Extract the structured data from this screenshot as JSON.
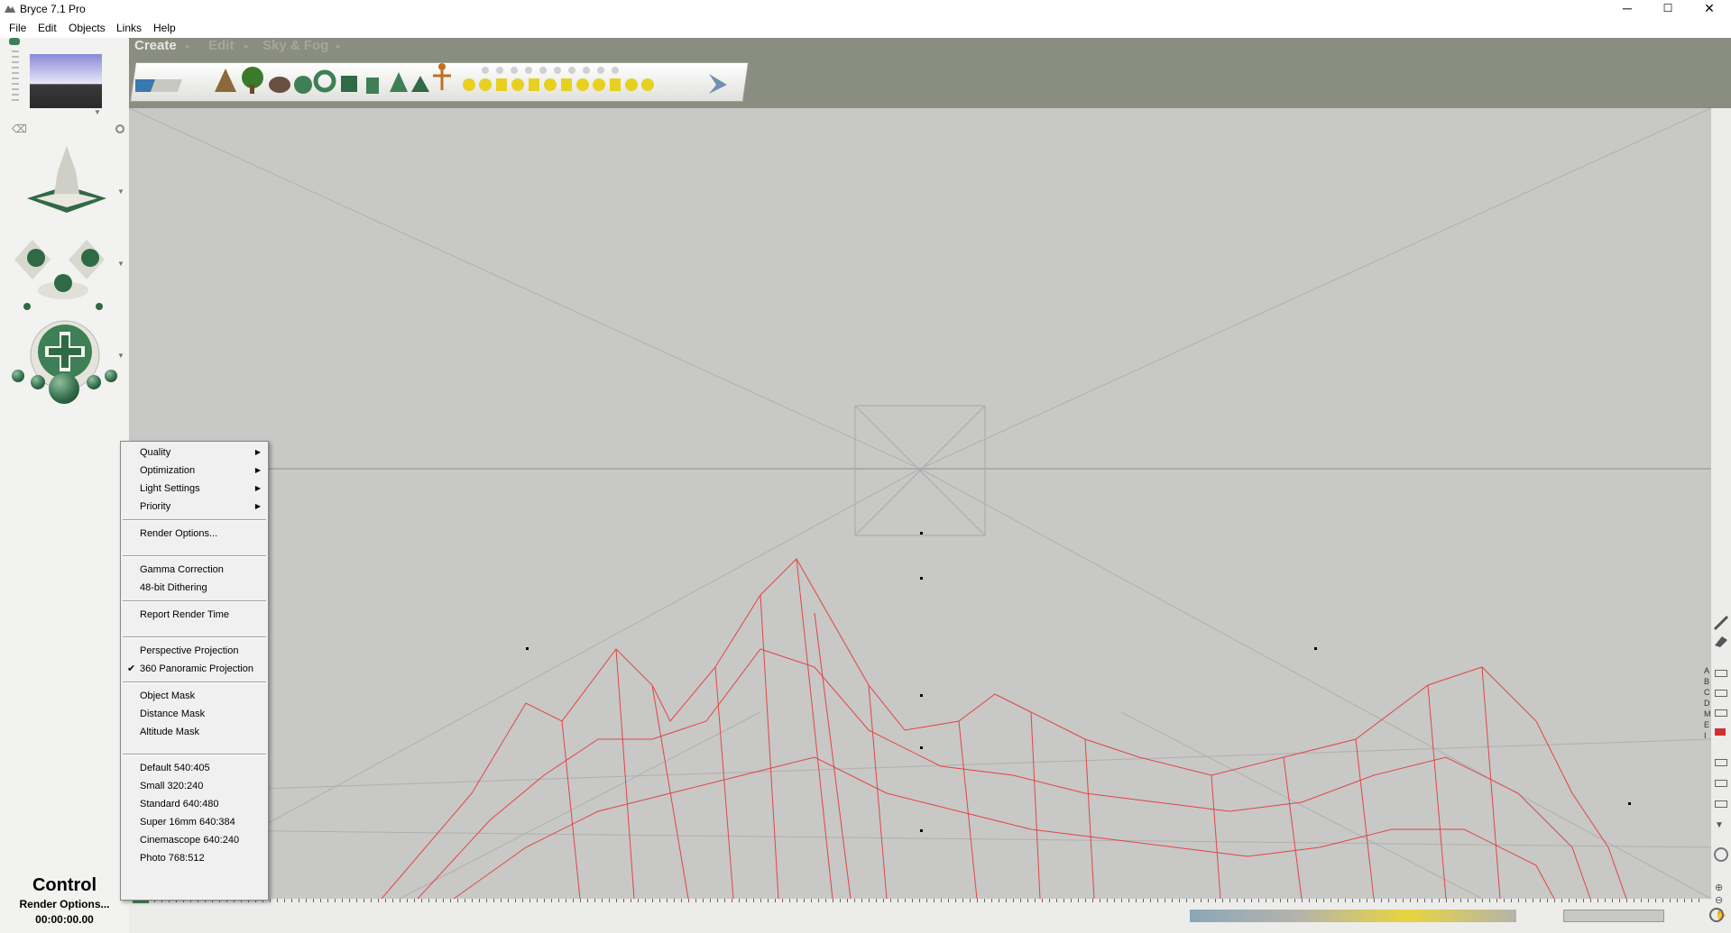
{
  "window": {
    "title": "Bryce 7.1  Pro",
    "controls": {
      "minimize": "─",
      "maximize": "☐",
      "close": "✕"
    }
  },
  "menubar": {
    "items": [
      "File",
      "Edit",
      "Objects",
      "Links",
      "Help"
    ]
  },
  "palettes": {
    "tabs": [
      "Create",
      "Edit",
      "Sky & Fog"
    ]
  },
  "context_menu": {
    "items": [
      {
        "label": "Quality",
        "submenu": true
      },
      {
        "label": "Optimization",
        "submenu": true
      },
      {
        "label": "Light Settings",
        "submenu": true
      },
      {
        "label": "Priority",
        "submenu": true
      },
      {
        "label": "Render Options..."
      },
      {
        "label": "Gamma Correction"
      },
      {
        "label": "48-bit Dithering"
      },
      {
        "label": "Report Render Time"
      },
      {
        "label": "Perspective Projection"
      },
      {
        "label": "360 Panoramic Projection",
        "checked": true
      },
      {
        "label": "Object Mask"
      },
      {
        "label": "Distance Mask"
      },
      {
        "label": "Altitude Mask"
      },
      {
        "label": "Default 540:405"
      },
      {
        "label": "Small 320:240"
      },
      {
        "label": "Standard 640:480"
      },
      {
        "label": "Super 16mm 640:384"
      },
      {
        "label": "Cinemascope 640:240"
      },
      {
        "label": "Photo 768:512"
      }
    ]
  },
  "control_panel": {
    "title": "Control",
    "subtitle": "Render Options...",
    "time": "00:00:00.00"
  },
  "right_labels": [
    "A",
    "B",
    "C",
    "D",
    "M",
    "E",
    "I"
  ],
  "colors": {
    "palette_bar": "#8a8e80",
    "viewport": "#c8c8c6",
    "wireframe": "#e04646",
    "control_green": "#2f6a45"
  },
  "icons": {
    "app": "bryce-app-icon",
    "check": "checkmark-icon",
    "submenu": "submenu-arrow-icon"
  }
}
